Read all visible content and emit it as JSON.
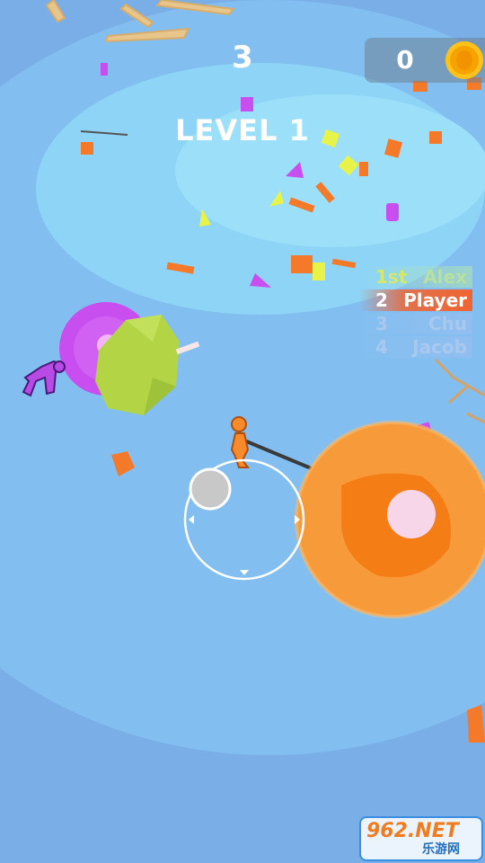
{
  "hud": {
    "score": "3",
    "level": "LEVEL 1",
    "coins": "0"
  },
  "leaderboard": [
    {
      "rank": "1st",
      "name": "Alex"
    },
    {
      "rank": "2",
      "name": "Player"
    },
    {
      "rank": "3",
      "name": "Chu"
    },
    {
      "rank": "4",
      "name": "Jacob"
    }
  ],
  "watermark": {
    "brand": "962.NET",
    "sub": "乐游网"
  },
  "icons": {
    "coin": "coin-icon",
    "joystick": "joystick-icon"
  },
  "colors": {
    "water": "#7aaee6",
    "arena_light": "#8ed0f4",
    "player": "#f78a2a",
    "enemy_purple": "#b84be6",
    "planet_orange": "#f79a3a",
    "planet_purple": "#c94ef0",
    "planet_green": "#b3d444",
    "leaderboard_player": "#f06432"
  }
}
